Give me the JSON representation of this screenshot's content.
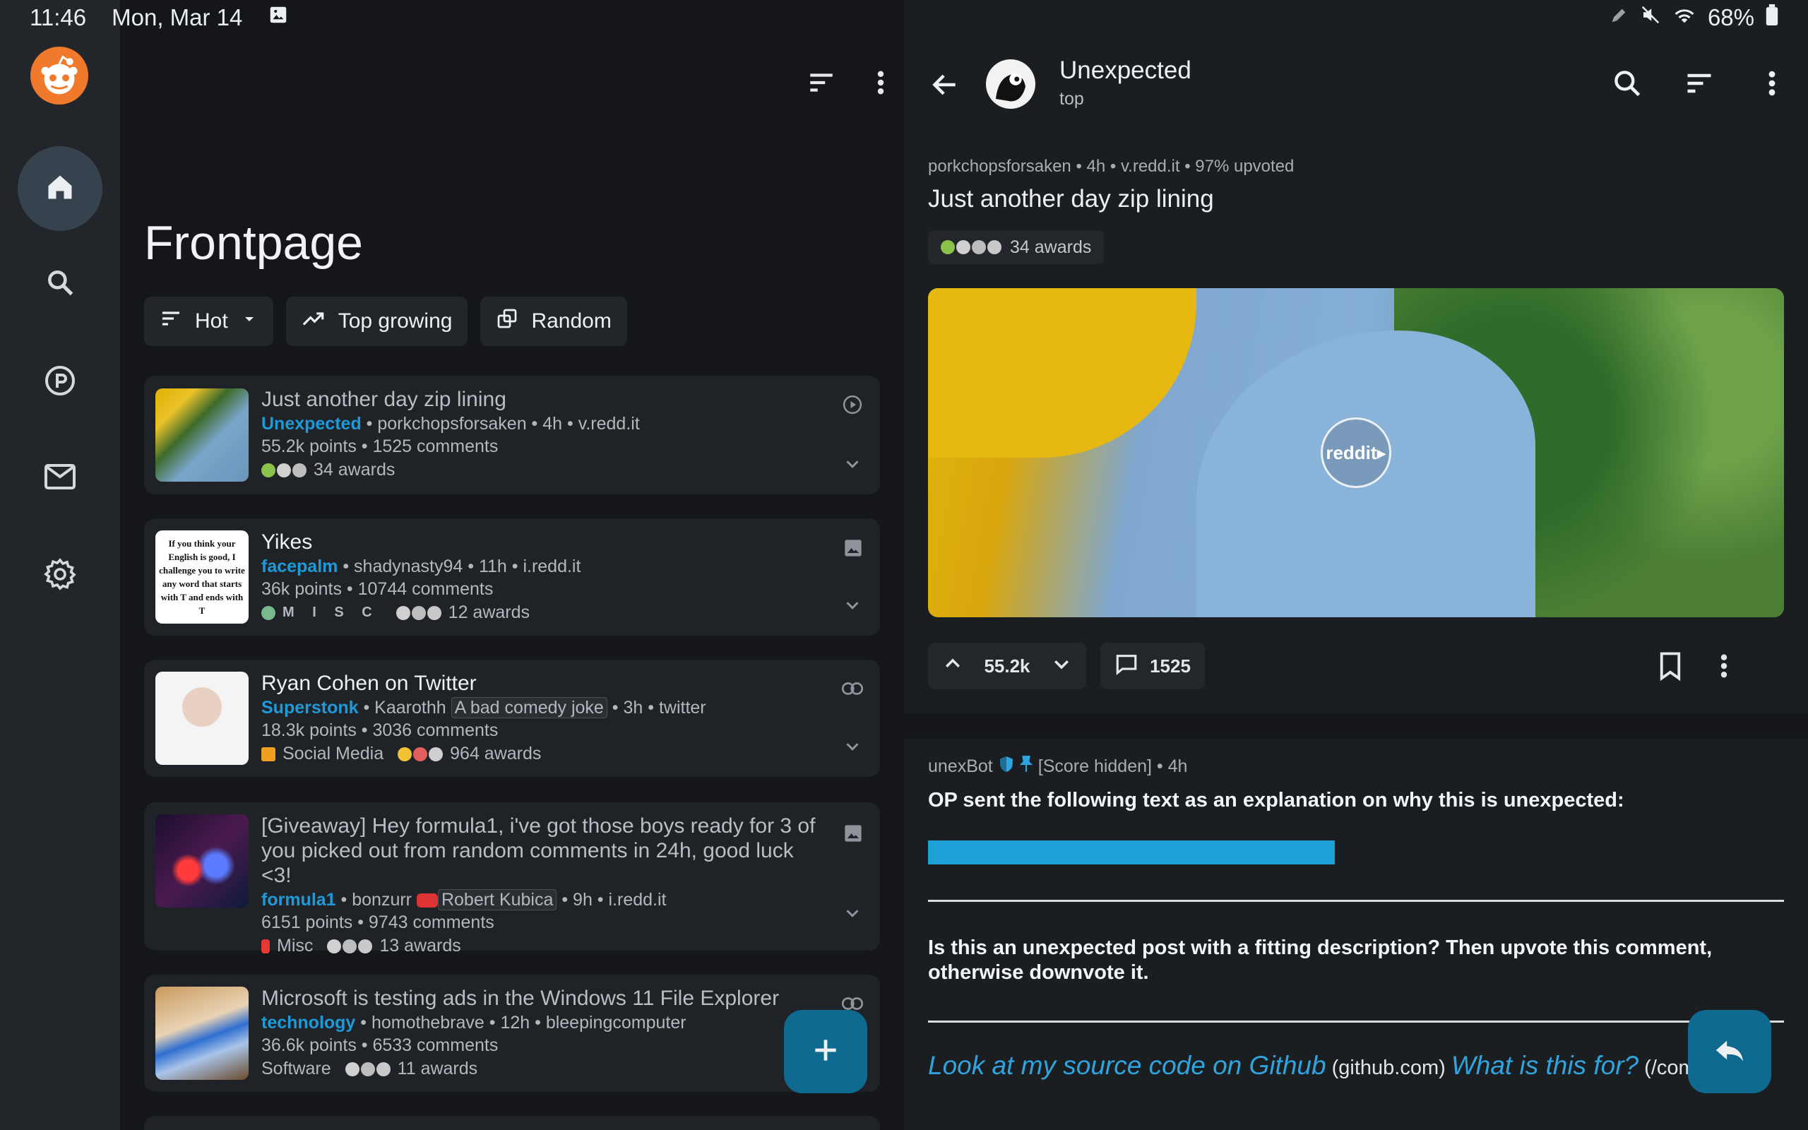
{
  "status": {
    "time": "11:46",
    "date": "Mon, Mar 14",
    "battery": "68%"
  },
  "rail": {
    "items": [
      "home-icon",
      "search-icon",
      "subreddit-icon",
      "mail-icon",
      "settings-icon"
    ]
  },
  "feed": {
    "title": "Frontpage",
    "chips": [
      {
        "label": "Hot",
        "icon": "sort-icon"
      },
      {
        "label": "Top growing",
        "icon": "trending-icon"
      },
      {
        "label": "Random",
        "icon": "random-icon"
      }
    ],
    "posts": [
      {
        "title": "Just another day zip lining",
        "subreddit": "Unexpected",
        "meta": " • porkchopsforsaken • 4h • v.redd.it",
        "stats": "55.2k points • 1525 comments",
        "flair": "",
        "awards": "34 awards",
        "type_icon": "play-icon"
      },
      {
        "title": "Yikes",
        "subreddit": "facepalm",
        "meta": " • shadynasty94 • 11h • i.redd.it",
        "stats": "36k points • 10744 comments",
        "flair": "M I S C",
        "awards": "12 awards",
        "type_icon": "image-icon",
        "thumb_text": "If you think your English is good, I challenge you to write any word that starts with T and ends with T"
      },
      {
        "title": "Ryan Cohen on Twitter",
        "subreddit": "Superstonk",
        "meta": " • Kaarothh ",
        "user_flair": "A bad comedy joke",
        "meta2": " • 3h • twitter",
        "stats": "18.3k points • 3036 comments",
        "flair": "Social Media",
        "awards": "964 awards",
        "type_icon": "link-icon"
      },
      {
        "title": "[Giveaway] Hey formula1, i've got those boys ready for 3 of you picked out from random comments in 24h, good luck <3!",
        "subreddit": "formula1",
        "meta": " • bonzurr",
        "user_flair": "Robert Kubica",
        "meta2": " • 9h • i.redd.it",
        "stats": "6151 points • 9743 comments",
        "flair": "Misc",
        "awards": "13 awards",
        "type_icon": "image-icon"
      },
      {
        "title": "Microsoft is testing ads in the Windows 11 File Explorer",
        "subreddit": "technology",
        "meta": " • homothebrave • 12h • bleepingcomputer",
        "stats": "36.6k points • 6533 comments",
        "flair": "Software",
        "awards": "11 awards",
        "type_icon": "link-icon"
      }
    ]
  },
  "detail": {
    "subreddit": "Unexpected",
    "sort": "top",
    "meta": "porkchopsforsaken • 4h • v.redd.it • 97% upvoted",
    "title": "Just another day zip lining",
    "awards": "34 awards",
    "watermark": "reddit",
    "score": "55.2k",
    "comments": "1525",
    "comment": {
      "author": "unexBot",
      "score": "[Score hidden] • 4h",
      "body1": "OP sent the following text as an explanation on why this is unexpected:",
      "body2": "Is this an unexpected post with a fitting description? Then upvote this comment, otherwise downvote it.",
      "link1": "Look at my source code on Github",
      "link1_domain": " (github.com) ",
      "link2": "What is this for?",
      "link2_domain": " (/com"
    }
  },
  "colors": {
    "accent": "#1e9ad8",
    "background": "#141619",
    "card": "#1f2226",
    "fab": "#0e6a8f"
  }
}
